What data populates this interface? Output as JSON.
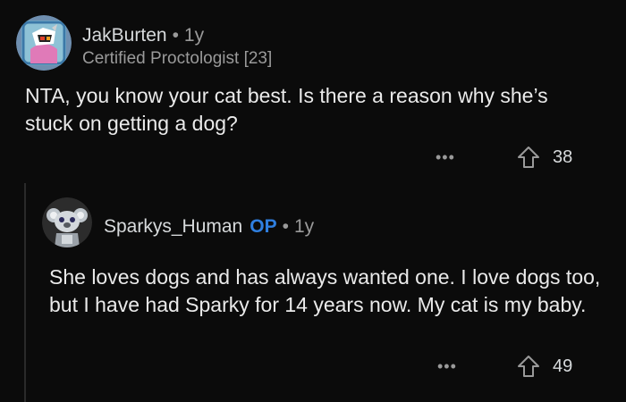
{
  "comments": [
    {
      "username": "JakBurten",
      "separator": "•",
      "age": "1y",
      "flair": "Certified Proctologist [23]",
      "body": "NTA, you know your cat best. Is there a reason why she’s stuck on getting a dog?",
      "more": "•••",
      "upvotes": "38",
      "avatar_icon": "robot-avatar-icon"
    },
    {
      "username": "Sparkys_Human",
      "op_tag": "OP",
      "separator": "•",
      "age": "1y",
      "body": "She loves dogs and has always wanted one.  I love dogs too, but I have had Sparky for 14 years now.  My cat is my baby.",
      "more": "•••",
      "upvotes": "49",
      "avatar_icon": "koala-avatar-icon"
    }
  ],
  "colors": {
    "background": "#0b0b0b",
    "op": "#2f7fe0",
    "muted": "#9a9a9a"
  }
}
